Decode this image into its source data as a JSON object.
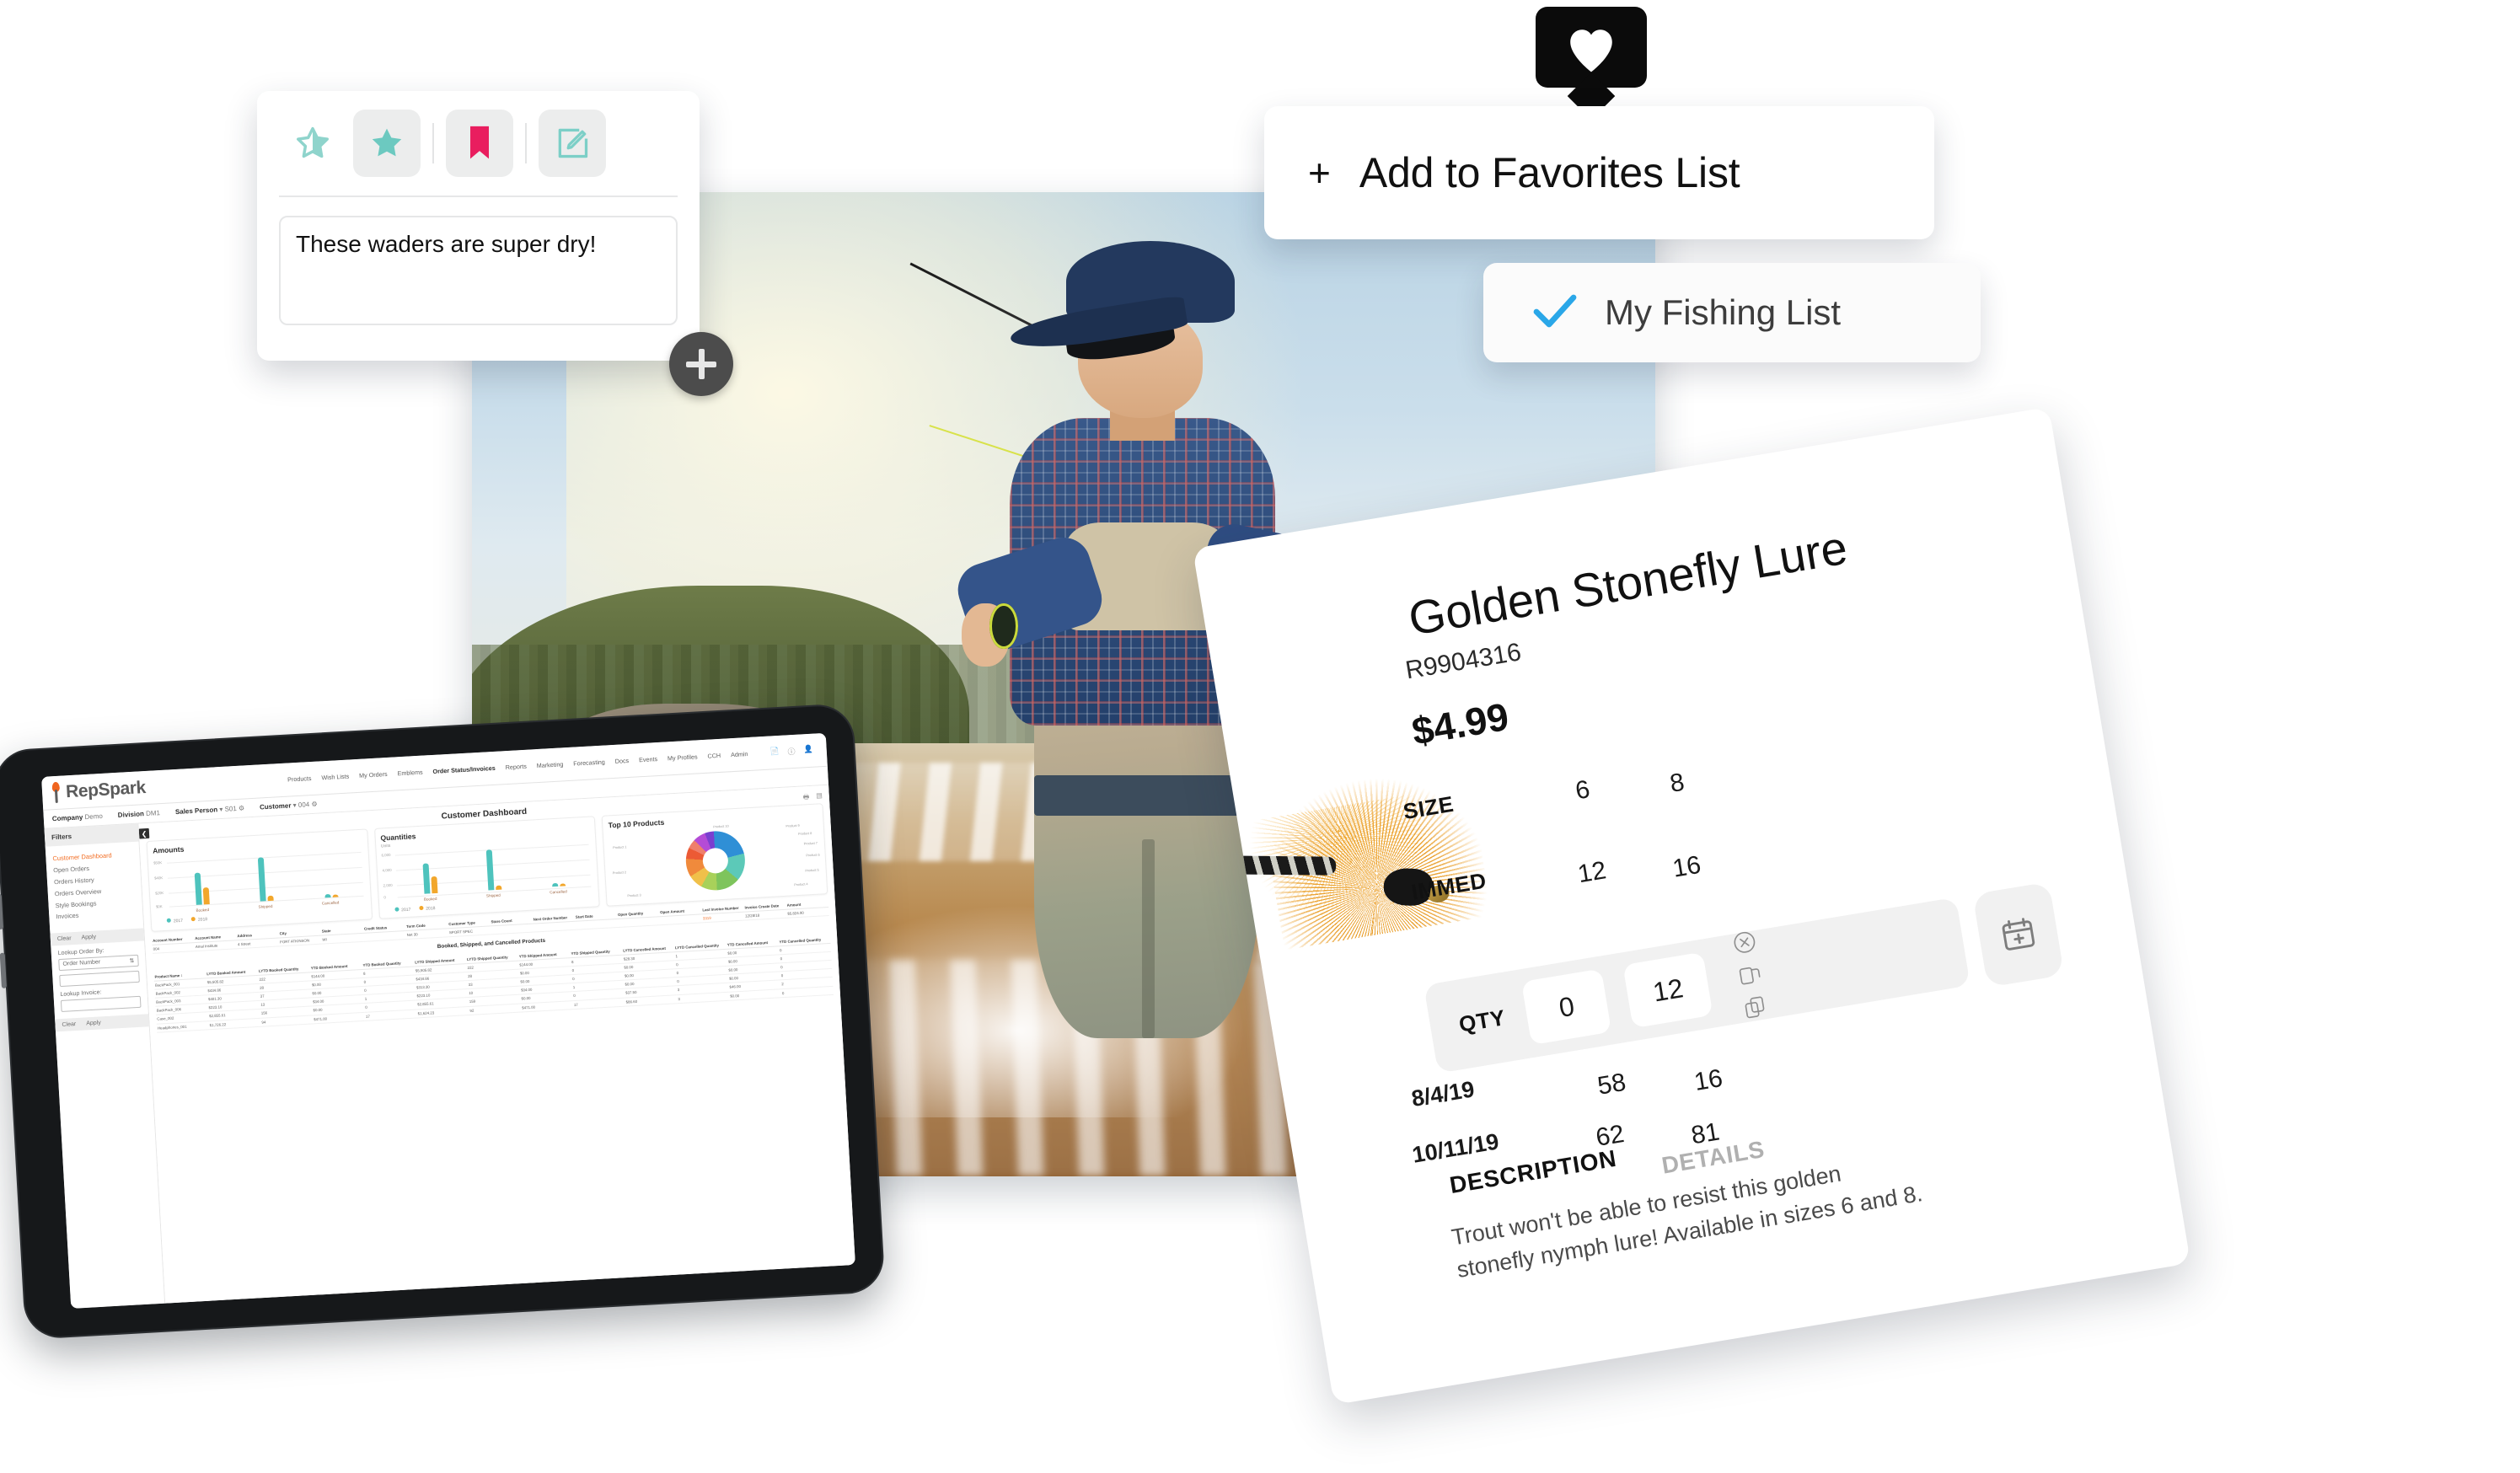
{
  "review_card": {
    "icons": [
      {
        "name": "half-star-icon",
        "color": "#8fd4cc"
      },
      {
        "name": "filled-star-icon",
        "color": "#6cc9c0"
      },
      {
        "name": "bookmark-icon",
        "color": "#e91e5f"
      },
      {
        "name": "edit-note-icon",
        "color": "#7ccfc7"
      }
    ],
    "note_text": "These waders are super dry!"
  },
  "plus_button": {
    "label": "+",
    "name": "add-image-button"
  },
  "heart_pin": {
    "icon": "heart-icon",
    "color": "#0b0b0b"
  },
  "favorites": {
    "plus": "+",
    "label": "Add to Favorites List",
    "list_item": {
      "label": "My Fishing List",
      "checked": true,
      "check_color": "#2aa7e8"
    }
  },
  "product": {
    "title": "Golden Stonefly Lure",
    "sku": "R9904316",
    "price": "$4.99",
    "size_label": "SIZE",
    "sizes": [
      "6",
      "8"
    ],
    "immed_label": "IMMED",
    "immed": [
      "12",
      "16"
    ],
    "qty_label": "QTY",
    "qty_values": [
      "0",
      "12"
    ],
    "qty_icons": [
      "clear-icon",
      "copy-right-icon",
      "copy-down-icon"
    ],
    "calendar_icon": "calendar-add-icon",
    "future_rows": [
      {
        "date": "8/4/19",
        "values": [
          "58",
          "16"
        ]
      },
      {
        "date": "10/11/19",
        "values": [
          "62",
          "81"
        ]
      }
    ],
    "tabs": [
      {
        "label": "DESCRIPTION",
        "active": true
      },
      {
        "label": "DETAILS",
        "active": false
      }
    ],
    "description": "Trout won't be able to resist this golden stonefly nymph lure! Available in sizes 6 and 8."
  },
  "tablet": {
    "brand": "RepSpark",
    "nav": [
      "Products",
      "Wish Lists",
      "My Orders",
      "Emblems",
      "Order Status/Invoices",
      "Reports",
      "Marketing",
      "Forecasting",
      "Docs",
      "Events",
      "My Profiles",
      "CCH",
      "Admin"
    ],
    "nav_active": "Order Status/Invoices",
    "nav_icons": [
      "document-icon",
      "help-icon",
      "user-icon"
    ],
    "subbar": [
      {
        "label": "Company",
        "value": "Demo"
      },
      {
        "label": "Division",
        "value": "DM1"
      },
      {
        "label": "Sales Person",
        "value": "S01"
      },
      {
        "label": "Customer",
        "value": "004"
      }
    ],
    "filters_header": "Filters",
    "filter_items": [
      "Customer Dashboard",
      "Open Orders",
      "Orders History",
      "Orders Overview",
      "Style Bookings",
      "Invoices"
    ],
    "filter_active": "Customer Dashboard",
    "actions": [
      "Clear",
      "Apply"
    ],
    "lookup_order_label": "Lookup Order By:",
    "lookup_order_value": "Order Number",
    "lookup_order_input": "",
    "lookup_invoice_label": "Lookup Invoice:",
    "lookup_invoice_input": "",
    "page_title": "Customer Dashboard",
    "page_icons": [
      "print-icon",
      "export-icon"
    ],
    "account_table": {
      "headers": [
        "Account Number",
        "Account Name",
        "Address",
        "City",
        "State",
        "Credit Status",
        "Term Code",
        "Customer Type",
        "Store Count",
        "Next Order Number",
        "Start Date",
        "Open Quantity",
        "Open Amount",
        "Last Invoice Number",
        "Invoice Create Date",
        "Amount"
      ],
      "rows": [
        [
          "004",
          "Amal Institute",
          "4 Street",
          "FORT ATKINSON",
          "WI",
          "",
          "Net 30",
          "SPORT SPEC",
          "",
          "",
          "",
          "",
          "",
          "3319",
          "12/28/18",
          "$5,824.90"
        ]
      ]
    },
    "products_section_title": "Booked, Shipped, and Cancelled Products",
    "products_table": {
      "headers": [
        "Product Name",
        "LYTD Booked Amount",
        "LYTD Booked Quantity",
        "YTD Booked Amount",
        "YTD Booked Quantity",
        "LYTD Shipped Amount",
        "LYTD Shipped Quantity",
        "YTD Shipped Amount",
        "YTD Shipped Quantity",
        "LYTD Cancelled Amount",
        "LYTD Cancelled Quantity",
        "YTD Cancelled Amount",
        "YTD Cancelled Quantity"
      ],
      "rows": [
        [
          "BackPack_001",
          "$5,505.82",
          "222",
          "$144.00",
          "8",
          "$5,505.82",
          "222",
          "$144.00",
          "8",
          "$28.30",
          "1",
          "$0.00",
          "0"
        ],
        [
          "BackPack_002",
          "$434.86",
          "28",
          "$0.00",
          "0",
          "$434.86",
          "28",
          "$0.00",
          "0",
          "$0.00",
          "0",
          "$0.00",
          "0"
        ],
        [
          "BackPack_003",
          "$401.30",
          "37",
          "$0.00",
          "0",
          "$313.30",
          "33",
          "$0.00",
          "0",
          "$0.00",
          "0",
          "$0.00",
          "0"
        ],
        [
          "BackPack_006",
          "$223.10",
          "13",
          "$34.00",
          "1",
          "$223.10",
          "10",
          "$34.00",
          "1",
          "$0.00",
          "0",
          "$0.00",
          "0"
        ],
        [
          "Case_002",
          "$2,855.61",
          "156",
          "$0.00",
          "0",
          "$2,855.61",
          "159",
          "$0.00",
          "0",
          "$37.50",
          "3",
          "$46.00",
          "2"
        ],
        [
          "Headphones_001",
          "$1,726.22",
          "94",
          "$471.00",
          "17",
          "$1,624.23",
          "92",
          "$471.00",
          "17",
          "$86.60",
          "3",
          "$0.00",
          "0"
        ]
      ]
    }
  },
  "chart_data": [
    {
      "type": "bar",
      "title": "Amounts",
      "categories": [
        "Booked",
        "Shipped",
        "Cancelled"
      ],
      "series": [
        {
          "name": "2017",
          "color": "#4ec3bd",
          "values": [
            37000,
            51000,
            2000
          ]
        },
        {
          "name": "2018",
          "color": "#f2a72c",
          "values": [
            19000,
            3000,
            1200
          ]
        }
      ],
      "ylabel": "",
      "xlabel": "",
      "ytick_labels": [
        "$0K",
        "$20K",
        "$40K",
        "$50K"
      ],
      "ylim": [
        0,
        55000
      ],
      "legend": "bottom-left",
      "grid": true
    },
    {
      "type": "bar",
      "title": "Quantities",
      "subtitle": "Units",
      "categories": [
        "Booked",
        "Shipped",
        "Cancelled"
      ],
      "series": [
        {
          "name": "2017",
          "color": "#4ec3bd",
          "values": [
            5400,
            6000,
            320
          ]
        },
        {
          "name": "2018",
          "color": "#f2a72c",
          "values": [
            2900,
            500,
            250
          ]
        }
      ],
      "ylabel": "Units",
      "xlabel": "",
      "ytick_labels": [
        "0",
        "2,000",
        "4,000",
        "6,000"
      ],
      "ylim": [
        0,
        6400
      ],
      "legend": "bottom-left",
      "grid": true
    },
    {
      "type": "pie",
      "title": "Top 10 Products",
      "labels": [
        "Product 1",
        "Product 2",
        "Product 3",
        "Product 4",
        "Product 5",
        "Product 6",
        "Product 7",
        "Product 8",
        "Product 9",
        "Product 10"
      ],
      "values": [
        22,
        15,
        13,
        9,
        8,
        10,
        6,
        5,
        7,
        5
      ],
      "colors": [
        "#2f8fd6",
        "#5cc9b8",
        "#7ec45c",
        "#a8d15a",
        "#f0c04a",
        "#f08a3c",
        "#ec5a35",
        "#ef7f6b",
        "#b44cd6",
        "#7a3fd0"
      ],
      "legend": "labels-around"
    }
  ]
}
